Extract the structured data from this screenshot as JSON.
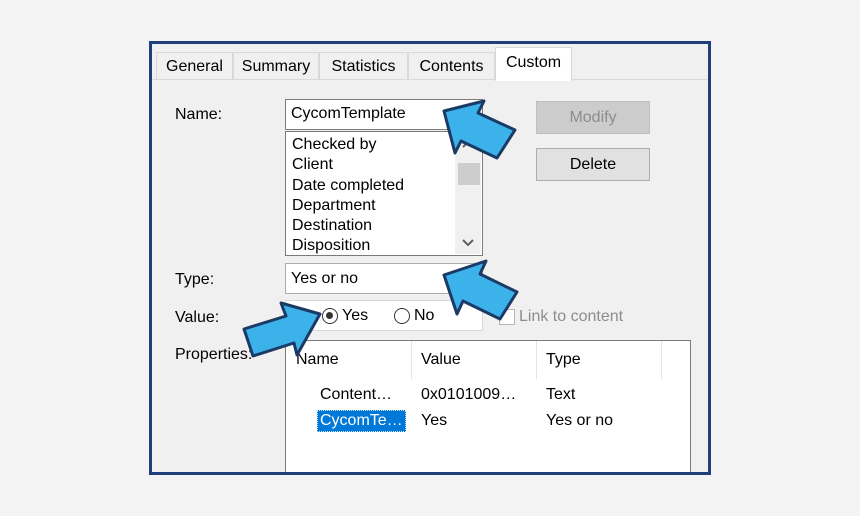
{
  "tabs": [
    {
      "label": "General"
    },
    {
      "label": "Summary"
    },
    {
      "label": "Statistics"
    },
    {
      "label": "Contents"
    },
    {
      "label": "Custom"
    }
  ],
  "active_tab": "Custom",
  "name_label": "Name:",
  "name_value": "CycomTemplate",
  "name_list": [
    "Checked by",
    "Client",
    "Date completed",
    "Department",
    "Destination",
    "Disposition"
  ],
  "modify_label": "Modify",
  "delete_label": "Delete",
  "type_label": "Type:",
  "type_value": "Yes or no",
  "value_label": "Value:",
  "value_yes": "Yes",
  "value_no": "No",
  "value_selected": "Yes",
  "link_label": "Link to content",
  "properties_label": "Properties:",
  "table": {
    "columns": [
      "Name",
      "Value",
      "Type"
    ],
    "rows": [
      {
        "name": "Content…",
        "value": "0x0101009…",
        "type": "Text"
      },
      {
        "name": "CycomTe…",
        "value": "Yes",
        "type": "Yes or no",
        "selected": true
      }
    ]
  },
  "colors": {
    "arrow_fill": "#3bb3ea",
    "arrow_stroke": "#1b3a66",
    "frame_border": "#1e3f7a",
    "selection": "#0078d7"
  },
  "icons": [
    "chevron-up-icon",
    "chevron-down-icon",
    "arrow-pointer-icon"
  ]
}
